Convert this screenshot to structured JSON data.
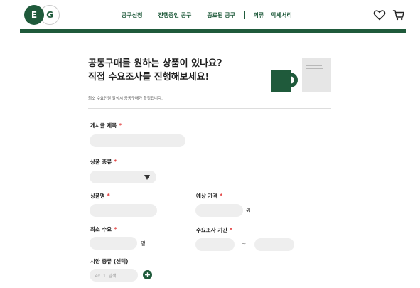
{
  "header": {
    "logo": {
      "letter1": "E",
      "letter2": "G"
    },
    "nav": [
      "공구신청",
      "진행중인 공구",
      "종료된 공구",
      "의류",
      "악세서리"
    ],
    "icons": {
      "wishlist": "heart-icon",
      "cart": "cart-icon"
    },
    "colors": {
      "brand": "#1f5a3b",
      "required": "#e03131"
    }
  },
  "intro": {
    "heading_line1": "공동구매를 원하는 상품이 있나요?",
    "heading_line2": "직접 수요조사를 진행해보세요!",
    "subtext": "최소 수요인원 달성시 공동구매가 확정됩니다."
  },
  "form": {
    "post_title": {
      "label": "게시글 제목",
      "required_mark": "*",
      "value": ""
    },
    "category": {
      "label": "상품 종류",
      "required_mark": "*",
      "selected": ""
    },
    "product_name": {
      "label": "상품명",
      "required_mark": "*",
      "value": ""
    },
    "expected_price": {
      "label": "예상 가격",
      "required_mark": "*",
      "value": "",
      "unit": "원"
    },
    "min_demand": {
      "label": "최소 수요",
      "required_mark": "*",
      "value": "",
      "unit": "명"
    },
    "survey_period": {
      "label": "수요조사 기간",
      "required_mark": "*",
      "start": "",
      "separator": "~",
      "end": ""
    },
    "option_type": {
      "label": "시안 종류 (선택)",
      "placeholder": "ex. 1. 남색",
      "add_label": "+"
    }
  }
}
